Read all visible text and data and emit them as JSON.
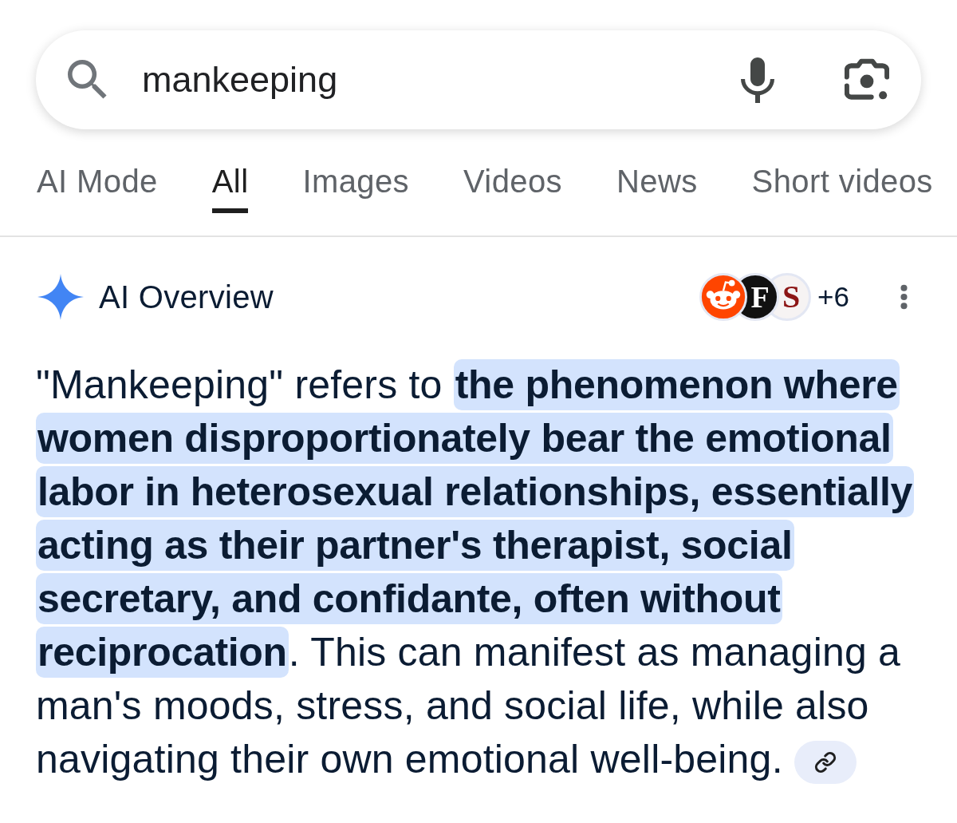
{
  "search": {
    "value": "mankeeping"
  },
  "tabs": [
    {
      "label": "AI Mode",
      "selected": false
    },
    {
      "label": "All",
      "selected": true
    },
    {
      "label": "Images",
      "selected": false
    },
    {
      "label": "Videos",
      "selected": false
    },
    {
      "label": "News",
      "selected": false
    },
    {
      "label": "Short videos",
      "selected": false
    }
  ],
  "ai_overview": {
    "title": "AI Overview",
    "sources": [
      {
        "kind": "mascot"
      },
      {
        "kind": "monogram",
        "letter": "F"
      },
      {
        "kind": "crest",
        "letter": "S"
      }
    ],
    "more_sources": "+6",
    "segments": [
      {
        "text": "\"Mankeeping\" refers to ",
        "highlighted": false
      },
      {
        "text": "the phenomenon where women disproportionately bear the emotional labor in heterosexual relationships, essentially acting as their partner's therapist, social secretary, and confidante, often without reciprocation",
        "highlighted": true
      },
      {
        "text": ". This can manifest as managing a man's moods, stress, and social life, while also navigating their own emotional well-being.",
        "highlighted": false
      }
    ]
  }
}
